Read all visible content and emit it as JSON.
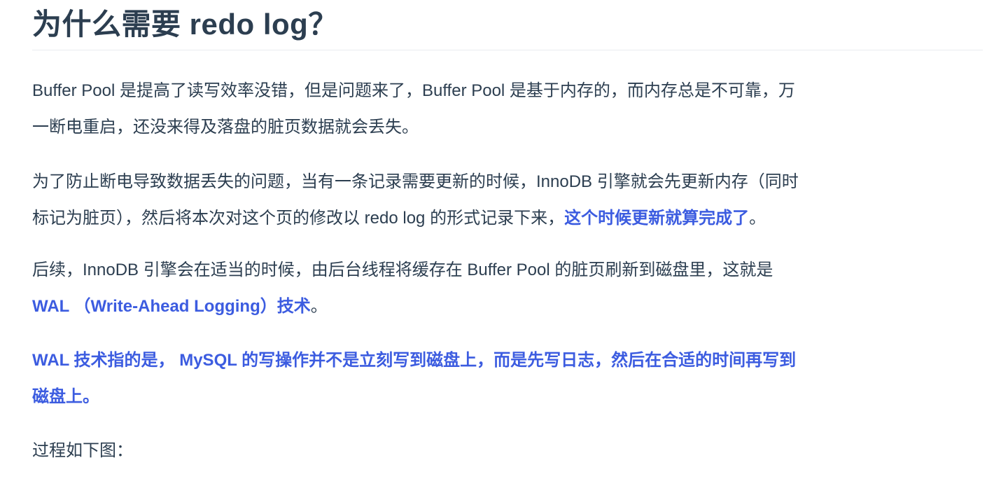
{
  "heading": "为什么需要 redo log？",
  "paragraphs": [
    {
      "lines": [
        "Buffer Pool 是提高了读写效率没错，但是问题来了，Buffer Pool 是基于内存的，而内存总是不可靠，万",
        "一断电重启，还没来得及落盘的脏页数据就会丢失。"
      ]
    },
    {
      "line1": "为了防止断电导致数据丢失的问题，当有一条记录需要更新的时候，InnoDB 引擎就会先更新内存（同时",
      "line2_plain": "标记为脏页），然后将本次对这个页的修改以 redo log 的形式记录下来，",
      "line2_strong": "这个时候更新就算完成了",
      "line2_end": "。"
    },
    {
      "line1": "后续，InnoDB 引擎会在适当的时候，由后台线程将缓存在 Buffer Pool 的脏页刷新到磁盘里，这就是",
      "line2_strong": "WAL （Write-Ahead Logging）技术",
      "line2_end": "。"
    },
    {
      "lines": [
        "WAL 技术指的是， MySQL 的写操作并不是立刻写到磁盘上，而是先写日志，然后在合适的时间再写到",
        "磁盘上。"
      ]
    },
    {
      "text": "过程如下图："
    }
  ],
  "colors": {
    "text": "#2c3e50",
    "emphasis": "#3c5ce0"
  }
}
